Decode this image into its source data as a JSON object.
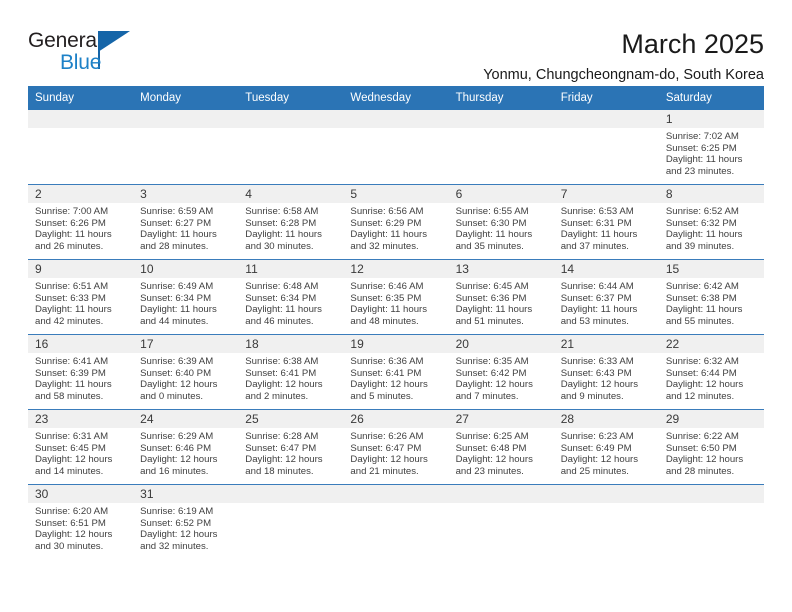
{
  "brand": {
    "name_top": "General",
    "name_bottom": "Blue",
    "accent_color": "#1565a8",
    "blue_text_color": "#1d81c7"
  },
  "header": {
    "month_title": "March 2025",
    "location": "Yonmu, Chungcheongnam-do, South Korea",
    "header_bg_color": "#2b74b5"
  },
  "calendar": {
    "weekday_headers": [
      "Sunday",
      "Monday",
      "Tuesday",
      "Wednesday",
      "Thursday",
      "Friday",
      "Saturday"
    ],
    "weeks": [
      [
        {
          "day": "",
          "empty": true
        },
        {
          "day": "",
          "empty": true
        },
        {
          "day": "",
          "empty": true
        },
        {
          "day": "",
          "empty": true
        },
        {
          "day": "",
          "empty": true
        },
        {
          "day": "",
          "empty": true
        },
        {
          "day": "1",
          "sunrise": "Sunrise: 7:02 AM",
          "sunset": "Sunset: 6:25 PM",
          "daylight_1": "Daylight: 11 hours",
          "daylight_2": "and 23 minutes."
        }
      ],
      [
        {
          "day": "2",
          "sunrise": "Sunrise: 7:00 AM",
          "sunset": "Sunset: 6:26 PM",
          "daylight_1": "Daylight: 11 hours",
          "daylight_2": "and 26 minutes."
        },
        {
          "day": "3",
          "sunrise": "Sunrise: 6:59 AM",
          "sunset": "Sunset: 6:27 PM",
          "daylight_1": "Daylight: 11 hours",
          "daylight_2": "and 28 minutes."
        },
        {
          "day": "4",
          "sunrise": "Sunrise: 6:58 AM",
          "sunset": "Sunset: 6:28 PM",
          "daylight_1": "Daylight: 11 hours",
          "daylight_2": "and 30 minutes."
        },
        {
          "day": "5",
          "sunrise": "Sunrise: 6:56 AM",
          "sunset": "Sunset: 6:29 PM",
          "daylight_1": "Daylight: 11 hours",
          "daylight_2": "and 32 minutes."
        },
        {
          "day": "6",
          "sunrise": "Sunrise: 6:55 AM",
          "sunset": "Sunset: 6:30 PM",
          "daylight_1": "Daylight: 11 hours",
          "daylight_2": "and 35 minutes."
        },
        {
          "day": "7",
          "sunrise": "Sunrise: 6:53 AM",
          "sunset": "Sunset: 6:31 PM",
          "daylight_1": "Daylight: 11 hours",
          "daylight_2": "and 37 minutes."
        },
        {
          "day": "8",
          "sunrise": "Sunrise: 6:52 AM",
          "sunset": "Sunset: 6:32 PM",
          "daylight_1": "Daylight: 11 hours",
          "daylight_2": "and 39 minutes."
        }
      ],
      [
        {
          "day": "9",
          "sunrise": "Sunrise: 6:51 AM",
          "sunset": "Sunset: 6:33 PM",
          "daylight_1": "Daylight: 11 hours",
          "daylight_2": "and 42 minutes."
        },
        {
          "day": "10",
          "sunrise": "Sunrise: 6:49 AM",
          "sunset": "Sunset: 6:34 PM",
          "daylight_1": "Daylight: 11 hours",
          "daylight_2": "and 44 minutes."
        },
        {
          "day": "11",
          "sunrise": "Sunrise: 6:48 AM",
          "sunset": "Sunset: 6:34 PM",
          "daylight_1": "Daylight: 11 hours",
          "daylight_2": "and 46 minutes."
        },
        {
          "day": "12",
          "sunrise": "Sunrise: 6:46 AM",
          "sunset": "Sunset: 6:35 PM",
          "daylight_1": "Daylight: 11 hours",
          "daylight_2": "and 48 minutes."
        },
        {
          "day": "13",
          "sunrise": "Sunrise: 6:45 AM",
          "sunset": "Sunset: 6:36 PM",
          "daylight_1": "Daylight: 11 hours",
          "daylight_2": "and 51 minutes."
        },
        {
          "day": "14",
          "sunrise": "Sunrise: 6:44 AM",
          "sunset": "Sunset: 6:37 PM",
          "daylight_1": "Daylight: 11 hours",
          "daylight_2": "and 53 minutes."
        },
        {
          "day": "15",
          "sunrise": "Sunrise: 6:42 AM",
          "sunset": "Sunset: 6:38 PM",
          "daylight_1": "Daylight: 11 hours",
          "daylight_2": "and 55 minutes."
        }
      ],
      [
        {
          "day": "16",
          "sunrise": "Sunrise: 6:41 AM",
          "sunset": "Sunset: 6:39 PM",
          "daylight_1": "Daylight: 11 hours",
          "daylight_2": "and 58 minutes."
        },
        {
          "day": "17",
          "sunrise": "Sunrise: 6:39 AM",
          "sunset": "Sunset: 6:40 PM",
          "daylight_1": "Daylight: 12 hours",
          "daylight_2": "and 0 minutes."
        },
        {
          "day": "18",
          "sunrise": "Sunrise: 6:38 AM",
          "sunset": "Sunset: 6:41 PM",
          "daylight_1": "Daylight: 12 hours",
          "daylight_2": "and 2 minutes."
        },
        {
          "day": "19",
          "sunrise": "Sunrise: 6:36 AM",
          "sunset": "Sunset: 6:41 PM",
          "daylight_1": "Daylight: 12 hours",
          "daylight_2": "and 5 minutes."
        },
        {
          "day": "20",
          "sunrise": "Sunrise: 6:35 AM",
          "sunset": "Sunset: 6:42 PM",
          "daylight_1": "Daylight: 12 hours",
          "daylight_2": "and 7 minutes."
        },
        {
          "day": "21",
          "sunrise": "Sunrise: 6:33 AM",
          "sunset": "Sunset: 6:43 PM",
          "daylight_1": "Daylight: 12 hours",
          "daylight_2": "and 9 minutes."
        },
        {
          "day": "22",
          "sunrise": "Sunrise: 6:32 AM",
          "sunset": "Sunset: 6:44 PM",
          "daylight_1": "Daylight: 12 hours",
          "daylight_2": "and 12 minutes."
        }
      ],
      [
        {
          "day": "23",
          "sunrise": "Sunrise: 6:31 AM",
          "sunset": "Sunset: 6:45 PM",
          "daylight_1": "Daylight: 12 hours",
          "daylight_2": "and 14 minutes."
        },
        {
          "day": "24",
          "sunrise": "Sunrise: 6:29 AM",
          "sunset": "Sunset: 6:46 PM",
          "daylight_1": "Daylight: 12 hours",
          "daylight_2": "and 16 minutes."
        },
        {
          "day": "25",
          "sunrise": "Sunrise: 6:28 AM",
          "sunset": "Sunset: 6:47 PM",
          "daylight_1": "Daylight: 12 hours",
          "daylight_2": "and 18 minutes."
        },
        {
          "day": "26",
          "sunrise": "Sunrise: 6:26 AM",
          "sunset": "Sunset: 6:47 PM",
          "daylight_1": "Daylight: 12 hours",
          "daylight_2": "and 21 minutes."
        },
        {
          "day": "27",
          "sunrise": "Sunrise: 6:25 AM",
          "sunset": "Sunset: 6:48 PM",
          "daylight_1": "Daylight: 12 hours",
          "daylight_2": "and 23 minutes."
        },
        {
          "day": "28",
          "sunrise": "Sunrise: 6:23 AM",
          "sunset": "Sunset: 6:49 PM",
          "daylight_1": "Daylight: 12 hours",
          "daylight_2": "and 25 minutes."
        },
        {
          "day": "29",
          "sunrise": "Sunrise: 6:22 AM",
          "sunset": "Sunset: 6:50 PM",
          "daylight_1": "Daylight: 12 hours",
          "daylight_2": "and 28 minutes."
        }
      ],
      [
        {
          "day": "30",
          "sunrise": "Sunrise: 6:20 AM",
          "sunset": "Sunset: 6:51 PM",
          "daylight_1": "Daylight: 12 hours",
          "daylight_2": "and 30 minutes."
        },
        {
          "day": "31",
          "sunrise": "Sunrise: 6:19 AM",
          "sunset": "Sunset: 6:52 PM",
          "daylight_1": "Daylight: 12 hours",
          "daylight_2": "and 32 minutes."
        },
        {
          "day": "",
          "empty": true
        },
        {
          "day": "",
          "empty": true
        },
        {
          "day": "",
          "empty": true
        },
        {
          "day": "",
          "empty": true
        },
        {
          "day": "",
          "empty": true
        }
      ]
    ]
  }
}
